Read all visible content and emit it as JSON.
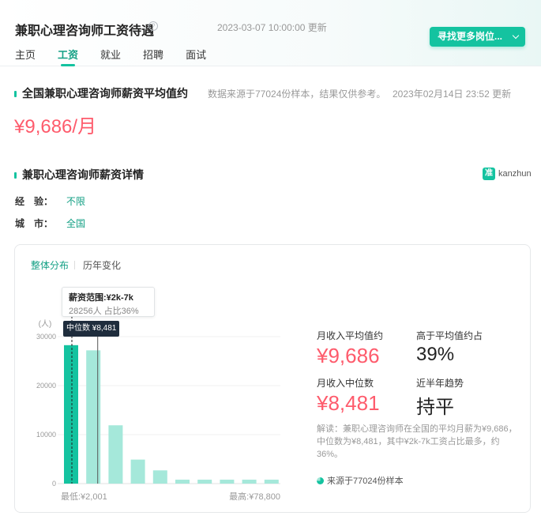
{
  "header": {
    "title": "兼职心理咨询师工资待遇",
    "help_icon": "?",
    "update_time": "2023-03-07 10:00:00 更新",
    "find_button": "寻找更多岗位...",
    "tabs": [
      "主页",
      "工资",
      "就业",
      "招聘",
      "面试"
    ],
    "active_tab": "工资"
  },
  "average": {
    "title": "全国兼职心理咨询师薪资平均值约",
    "note": "数据来源于77024份样本，结果仅供参考。",
    "updated": "2023年02月14日 23:52 更新",
    "value": "¥9,686/月"
  },
  "details": {
    "title": "兼职心理咨询师薪资详情",
    "brand_glyph": "准",
    "brand": "kanzhun",
    "filters": [
      {
        "label": "经　验：",
        "value": "不限"
      },
      {
        "label": "城　市：",
        "value": "全国"
      }
    ]
  },
  "panel": {
    "tabs": [
      "整体分布",
      "历年变化"
    ],
    "tooltip_title": "薪资范围:¥2k-7k",
    "tooltip_detail": "28256人 占比36%",
    "median_tag": "中位数 ¥8,481",
    "stats": {
      "avg_label": "月收入平均值约",
      "avg_value": "¥9,686",
      "above_label": "高于平均值约占",
      "above_value": "39%",
      "median_label": "月收入中位数",
      "median_value": "¥8,481",
      "trend_label": "近半年趋势",
      "trend_value": "持平"
    },
    "interpretation": "解读：兼职心理咨询师在全国的平均月薪为¥9,686，中位数为¥8,481，其中¥2k-7k工资占比最多，约36%。",
    "source": "来源于77024份样本"
  },
  "chart_data": {
    "type": "bar",
    "ylabel": "(人)",
    "ylim": [
      0,
      30000
    ],
    "yticks": [
      0,
      10000,
      20000,
      30000
    ],
    "values": [
      28256,
      27200,
      11900,
      4900,
      2700,
      800,
      800,
      800,
      800,
      800
    ],
    "highlight_index": 0,
    "x_min_label": "最低:¥2,001",
    "x_max_label": "最高:¥78,800",
    "median_line_pos": 0.58,
    "colors": {
      "highlight": "#14c3a0",
      "normal": "#a5e8da"
    }
  }
}
